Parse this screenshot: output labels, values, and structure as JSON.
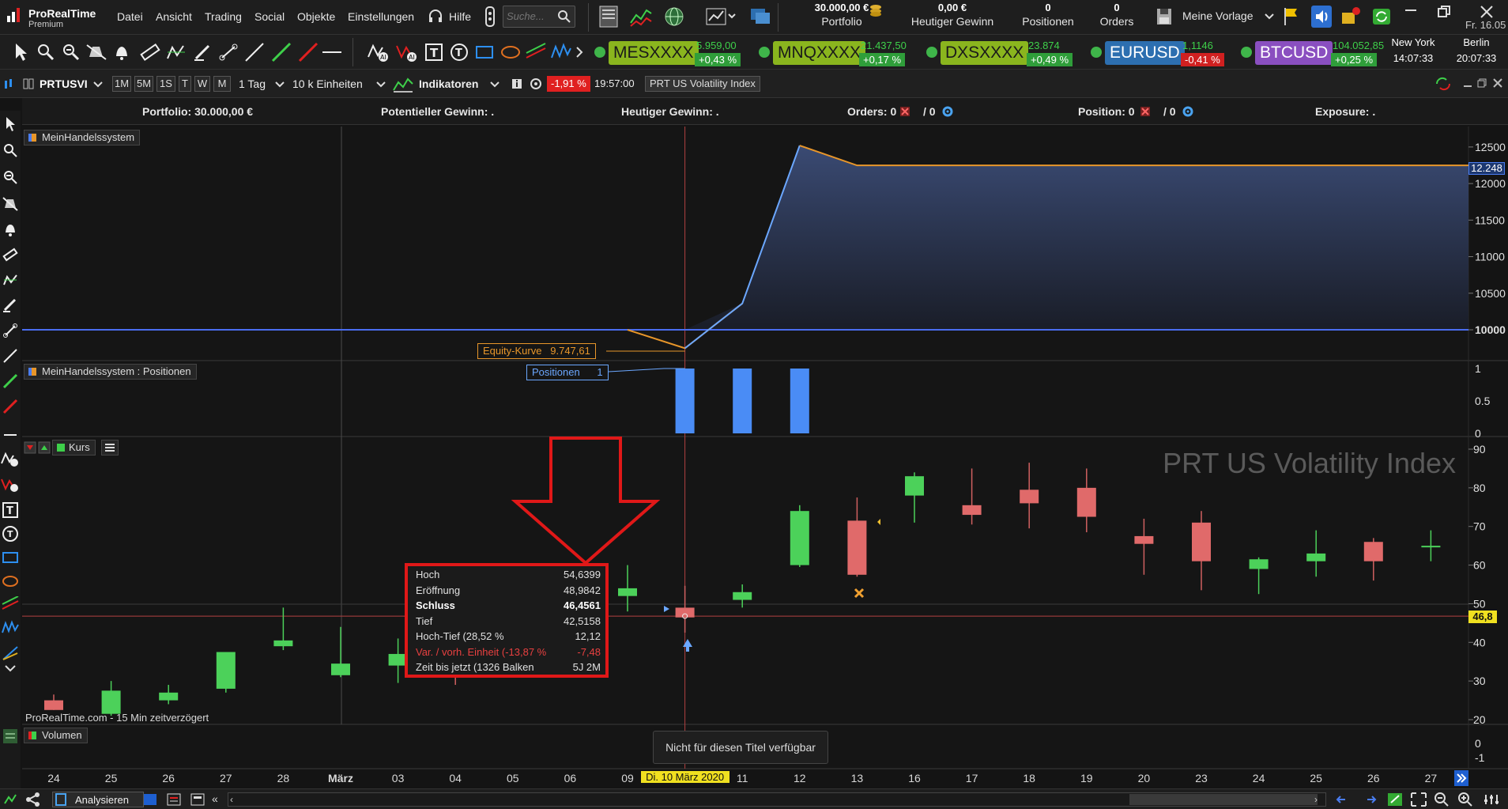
{
  "app": {
    "name": "ProRealTime",
    "edition": "Premium"
  },
  "menu": [
    "Datei",
    "Ansicht",
    "Trading",
    "Social",
    "Objekte",
    "Einstellungen"
  ],
  "help_label": "Hilfe",
  "search": {
    "placeholder": "Suche..."
  },
  "top_stats": {
    "portfolio_value": "30.000,00 €",
    "portfolio_label": "Portfolio",
    "daily_gain_value": "0,00 €",
    "daily_gain_label": "Heutiger Gewinn",
    "positions_value": "0",
    "positions_label": "Positionen",
    "orders_value": "0",
    "orders_label": "Orders"
  },
  "template_label": "Meine Vorlage",
  "date_short": "Fr. 16.05",
  "tickers": [
    {
      "symbol": "MESXXXX",
      "price": "5.959,00",
      "change": "+0,43 %",
      "dir": "up",
      "sym_color": "#8ab51e",
      "sym_text": "#1a1a1a"
    },
    {
      "symbol": "MNQXXXX",
      "price": "21.437,50",
      "change": "+0,17 %",
      "dir": "up",
      "sym_color": "#8ab51e",
      "sym_text": "#1a1a1a"
    },
    {
      "symbol": "DXSXXXX",
      "price": "23.874",
      "change": "+0,49 %",
      "dir": "up",
      "sym_color": "#8ab51e",
      "sym_text": "#1a1a1a"
    },
    {
      "symbol": "EURUSD",
      "price": "1,1146",
      "change": "-0,41 %",
      "dir": "down",
      "sym_color": "#2d6fb0",
      "sym_text": "#ffffff"
    },
    {
      "symbol": "BTCUSD",
      "price": "104.052,85",
      "change": "+0,25 %",
      "dir": "up",
      "sym_color": "#8a4fc0",
      "sym_text": "#ffffff"
    }
  ],
  "clocks": [
    {
      "city": "New York",
      "time": "14:07:33"
    },
    {
      "city": "Berlin",
      "time": "20:07:33"
    }
  ],
  "chart_header": {
    "instrument": "PRTUSVI",
    "timeframes": [
      "1M",
      "5M",
      "1S",
      "T",
      "W",
      "M"
    ],
    "period": "1 Tag",
    "units": "10 k Einheiten",
    "indicators_label": "Indikatoren",
    "change": "-1,91 %",
    "time": "19:57:00",
    "title": "PRT US Volatility Index"
  },
  "stats_bar": {
    "portfolio": "Portfolio: 30.000,00 €",
    "potential_gain": "Potentieller Gewinn: .",
    "daily_gain": "Heutiger Gewinn: .",
    "orders": "Orders: 0",
    "orders_suffix": "/ 0",
    "position": "Position: 0",
    "position_suffix": "/ 0",
    "exposure": "Exposure: ."
  },
  "panels": {
    "equity_label": "MeinHandelssystem",
    "positions_label": "MeinHandelssystem : Positionen",
    "price_label": "Kurs",
    "volume_label": "Volumen",
    "watermark": "PRT US Volatility Index",
    "delay_note": "ProRealTime.com - 15 Min zeitverzögert",
    "equity_callout": "Equity-Kurve   9.747,61",
    "positions_callout": "Positionen      1",
    "not_available": "Nicht für diesen Titel verfügbar",
    "last_price": "46,8",
    "equity_last": "12.248"
  },
  "tooltip": [
    {
      "k": "Hoch",
      "v": "54,6399",
      "bold": false,
      "color": "#e0e0e0"
    },
    {
      "k": "Eröffnung",
      "v": "48,9842",
      "bold": false,
      "color": "#e0e0e0"
    },
    {
      "k": "Schluss",
      "v": "46,4561",
      "bold": true,
      "color": "#ffffff"
    },
    {
      "k": "Tief",
      "v": "42,5158",
      "bold": false,
      "color": "#e0e0e0"
    },
    {
      "k": "Hoch-Tief (28,52 %",
      "v": "12,12",
      "bold": false,
      "color": "#e0e0e0"
    },
    {
      "k": "Var. / vorh. Einheit (-13,87 %",
      "v": "-7,48",
      "bold": false,
      "color": "#e84040"
    },
    {
      "k": "Zeit bis jetzt (1326 Balken",
      "v": "5J 2M",
      "bold": false,
      "color": "#e0e0e0"
    }
  ],
  "x_labels": [
    "24",
    "25",
    "26",
    "27",
    "28",
    "März",
    "03",
    "04",
    "05",
    "06",
    "09",
    "Di. 10 März 2020",
    "11",
    "12",
    "13",
    "16",
    "17",
    "18",
    "19",
    "20",
    "23",
    "24",
    "25",
    "26",
    "27"
  ],
  "bottom": {
    "analyze_label": "Analysieren"
  },
  "chart_data": {
    "type": "candlestick",
    "title": "PRT US Volatility Index",
    "categories": [
      "24",
      "25",
      "26",
      "27",
      "28",
      "02",
      "03",
      "04",
      "05",
      "06",
      "09",
      "10",
      "11",
      "12",
      "13",
      "16",
      "17",
      "18",
      "19",
      "20",
      "23",
      "24",
      "25",
      "26",
      "27"
    ],
    "ohlc": [
      [
        25,
        26.5,
        22.5,
        22.5
      ],
      [
        21.5,
        30,
        21,
        27.5
      ],
      [
        25,
        29,
        24,
        27
      ],
      [
        28,
        37.5,
        27,
        37.5
      ],
      [
        39,
        49,
        38,
        40.5
      ],
      [
        31.5,
        44,
        31,
        34.5
      ],
      [
        34,
        41,
        29.5,
        37
      ],
      [
        36,
        39,
        29,
        33
      ],
      [
        40,
        41.5,
        37,
        38
      ],
      [
        38.5,
        42.5,
        37.5,
        39
      ],
      [
        52,
        60,
        48,
        54
      ],
      [
        48.98,
        54.64,
        42.52,
        46.46
      ],
      [
        51,
        55,
        49,
        53
      ],
      [
        60,
        75.5,
        59.5,
        74
      ],
      [
        71.5,
        77.5,
        57,
        57.5
      ],
      [
        78,
        84,
        71,
        83
      ],
      [
        75.5,
        85,
        70.5,
        73
      ],
      [
        79.5,
        86.5,
        69.5,
        76
      ],
      [
        80,
        85,
        68.5,
        72.5
      ],
      [
        67.5,
        72,
        57.5,
        65.5
      ],
      [
        71,
        74,
        53.5,
        61
      ],
      [
        59,
        62,
        52.5,
        61.5
      ],
      [
        61,
        69,
        57,
        63
      ],
      [
        66,
        67,
        56,
        61
      ],
      [
        65,
        69,
        61,
        65
      ]
    ],
    "y_range": [
      20,
      90
    ],
    "y_ticks": [
      20,
      30,
      40,
      50,
      60,
      70,
      80,
      90
    ],
    "last_value": 46.8,
    "equity": {
      "x_index": [
        0,
        10,
        11,
        12,
        13,
        14,
        24
      ],
      "values": [
        10000,
        10000,
        9747.61,
        10360,
        12520,
        12248,
        12248
      ],
      "y_range": [
        9600,
        12650
      ],
      "y_ticks": [
        10000,
        10500,
        11000,
        11500,
        12000,
        12500
      ],
      "baseline": 10000
    },
    "positions": {
      "x_index": [
        11,
        12,
        13
      ],
      "values": [
        1,
        1,
        1
      ],
      "y_ticks": [
        0,
        0.5,
        1
      ]
    },
    "volume": {
      "y_ticks": [
        0,
        -1
      ]
    }
  }
}
